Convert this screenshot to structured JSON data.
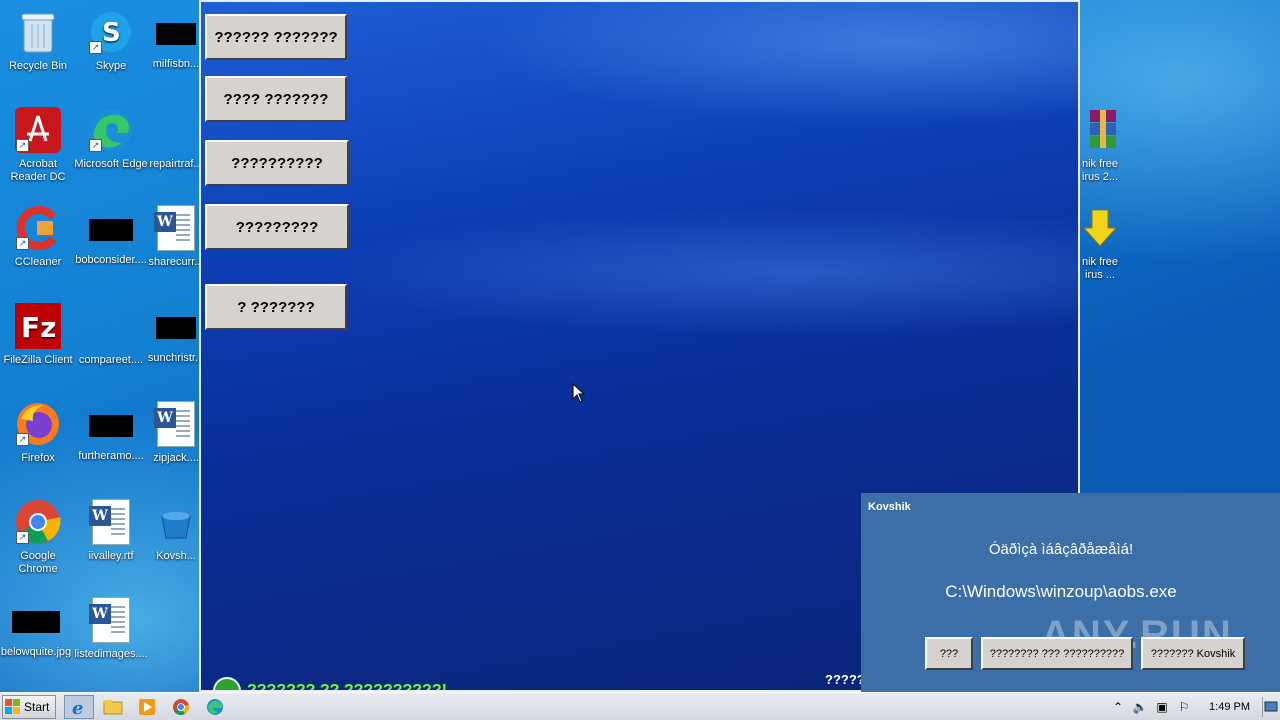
{
  "desktop": {
    "icons": [
      {
        "label": "Recycle Bin",
        "icon": "recycle-bin-icon"
      },
      {
        "label": "Skype",
        "icon": "skype-icon"
      },
      {
        "label": "milfisbn...",
        "icon": "black-box-icon"
      },
      {
        "label": "Acrobat Reader DC",
        "icon": "acrobat-icon"
      },
      {
        "label": "Microsoft Edge",
        "icon": "edge-icon"
      },
      {
        "label": "repairtraf...",
        "icon": "file-icon"
      },
      {
        "label": "CCleaner",
        "icon": "ccleaner-icon"
      },
      {
        "label": "bobconsider....",
        "icon": "black-box-icon"
      },
      {
        "label": "sharecurr...",
        "icon": "word-doc-icon"
      },
      {
        "label": "FileZilla Client",
        "icon": "filezilla-icon"
      },
      {
        "label": "compareet....",
        "icon": "file-icon"
      },
      {
        "label": "sunchristr...",
        "icon": "black-box-icon"
      },
      {
        "label": "Firefox",
        "icon": "firefox-icon"
      },
      {
        "label": "furtheramo....",
        "icon": "black-box-icon"
      },
      {
        "label": "zipjack....",
        "icon": "word-doc-icon"
      },
      {
        "label": "Google Chrome",
        "icon": "chrome-icon"
      },
      {
        "label": "iivalley.rtf",
        "icon": "word-doc-icon"
      },
      {
        "label": "Kovsh...",
        "icon": "kovshik-icon"
      },
      {
        "label": "belowquite.jpg",
        "icon": "black-box-icon"
      },
      {
        "label": "listedimages....",
        "icon": "word-doc-icon"
      },
      {
        "label": "nik free\nirus 2...",
        "icon": "winrar-icon"
      },
      {
        "label": "nik free\nirus ...",
        "icon": "download-icon"
      }
    ]
  },
  "malware_window": {
    "buttons": [
      "?????? ???????",
      "???? ???????",
      "??????????",
      "?????????",
      "? ???????"
    ],
    "progress_text": "??????? ?? ??????????!",
    "tail_text": "?????"
  },
  "dialog": {
    "title": "Kovshik",
    "message": "Óäðìçà ìáâçâðåæåìá!",
    "path": "C:\\Windows\\winzoup\\aobs.exe",
    "buttons": [
      "???",
      "???????? ??? ??????????",
      "??????? Kovshik"
    ],
    "watermark": "ANY.RUN"
  },
  "taskbar": {
    "start_label": "Start",
    "pinned": [
      "internet-explorer-icon",
      "explorer-folder-icon",
      "media-player-icon",
      "chrome-icon",
      "edge-icon"
    ],
    "tray_icons": [
      "chevron-up-icon",
      "volume-icon",
      "network-icon",
      "flag-icon"
    ],
    "clock": "1:49 PM"
  },
  "colors": {
    "dialog_bg": "#3c6ea8",
    "progress_green": "#6fff3a",
    "button_face": "#d6d3ce"
  }
}
